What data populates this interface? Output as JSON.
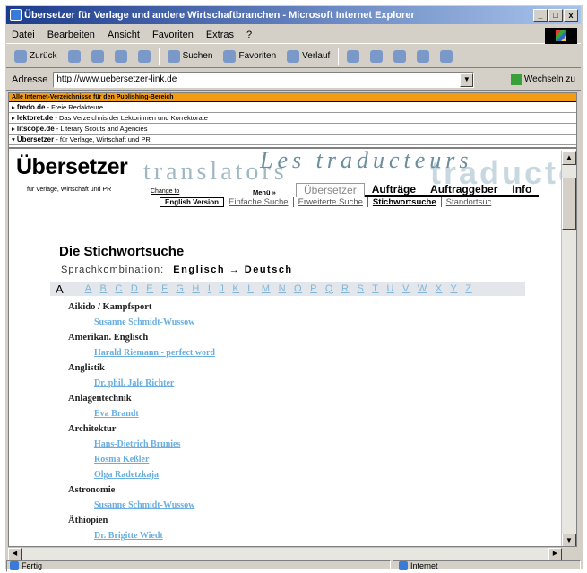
{
  "window": {
    "title": "Übersetzer für Verlage und andere Wirtschaftbranchen - Microsoft Internet Explorer",
    "controls": [
      "_",
      "□",
      "x"
    ]
  },
  "menubar": [
    "Datei",
    "Bearbeiten",
    "Ansicht",
    "Favoriten",
    "Extras",
    "?"
  ],
  "toolbar": {
    "back": "Zurück",
    "search": "Suchen",
    "favorites": "Favoriten",
    "history": "Verlauf"
  },
  "address": {
    "label": "Adresse",
    "url": "http://www.uebersetzer-link.de",
    "go": "Wechseln zu"
  },
  "framenav": {
    "header": "Alle Internet-Verzeichnisse für den Publishing-Bereich",
    "rows": [
      {
        "name": "fredo.de",
        "desc": " - Freie Redakteure"
      },
      {
        "name": "lektoret.de",
        "desc": " - Das Verzeichnis der Lektorinnen und Korrektorate"
      },
      {
        "name": "litscope.de",
        "desc": " - Literary Scouts and Agencies"
      },
      {
        "name": "Übersetzer",
        "desc": " - für Verlage, Wirtschaft und PR"
      }
    ]
  },
  "site": {
    "brand": "Übersetzer",
    "translators": "translators",
    "traducteurs": "Les traducteurs",
    "traducto": "traducto",
    "tagline": "für Verlage, Wirtschaft und PR",
    "change_to": "Change to",
    "menue": "Menü »",
    "tabs_main": [
      "Übersetzer",
      "Aufträge",
      "Auftraggeber",
      "Info"
    ],
    "english_version": "English Version",
    "tabs_sub": [
      "Einfache Suche",
      "Erweiterte Suche",
      "Stichwortsuche",
      "Standortsuc"
    ]
  },
  "page": {
    "title": "Die Stichwortsuche",
    "sprach_label": "Sprachkombination:",
    "sprach_value": "Englisch  →  Deutsch",
    "current_letter": "A",
    "letters": [
      "A",
      "B",
      "C",
      "D",
      "E",
      "F",
      "G",
      "H",
      "I",
      "J",
      "K",
      "L",
      "M",
      "N",
      "O",
      "P",
      "Q",
      "R",
      "S",
      "T",
      "U",
      "V",
      "W",
      "X",
      "Y",
      "Z"
    ]
  },
  "entries": [
    {
      "category": "Aikido / Kampfsport",
      "names": [
        "Susanne Schmidt-Wussow"
      ]
    },
    {
      "category": "Amerikan. Englisch",
      "names": [
        "Harald Riemann - perfect word"
      ]
    },
    {
      "category": "Anglistik",
      "names": [
        "Dr. phil. Jale Richter"
      ]
    },
    {
      "category": "Anlagentechnik",
      "names": [
        "Eva Brandt"
      ]
    },
    {
      "category": "Architektur",
      "names": [
        "Hans-Dietrich Brunies",
        "Rosma Keßler",
        "Olga Radetzkaja"
      ]
    },
    {
      "category": "Astronomie",
      "names": [
        "Susanne Schmidt-Wussow"
      ]
    },
    {
      "category": "Äthiopien",
      "names": [
        "Dr. Brigitte Wiedt"
      ]
    }
  ],
  "status": {
    "left": "Fertig",
    "zone": "Internet"
  }
}
